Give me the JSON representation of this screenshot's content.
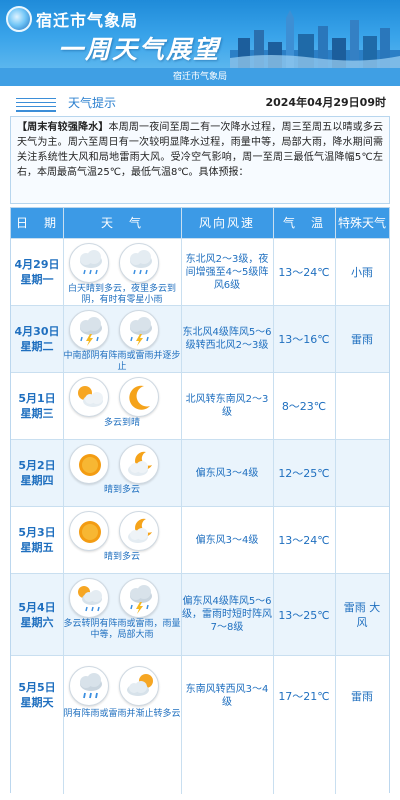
{
  "header": {
    "logo_text": "宿迁市气象局",
    "title": "一周天气展望",
    "subtitle": "宿迁市气象局"
  },
  "tip": {
    "label": "天气提示",
    "date": "2024年04月29日09时",
    "highlight": "【周末有较强降水】",
    "body": "本周周一夜间至周二有一次降水过程，周三至周五以晴或多云天气为主。周六至周日有一次较明显降水过程，雨量中等，局部大雨，降水期间需关注系统性大风和局地雷雨大风。受冷空气影响，周一至周三最低气温降幅5℃左右，本周最高气温25℃，最低气温8℃。具体预报："
  },
  "table": {
    "headers": {
      "date": "日　期",
      "weather": "天　气",
      "wind": "风向风速",
      "temp": "气　温",
      "special": "特殊天气"
    },
    "rows": [
      {
        "date": "4月29日",
        "weekday": "星期一",
        "icon1": "light-rain-cloud-icon",
        "icon2": "light-rain-cloud-icon",
        "desc": "白天晴到多云，夜里多云到阴，有时有零星小雨",
        "wind": "东北风2～3级，夜间增强至4～5级阵风6级",
        "temp": "13～24℃",
        "special": "小雨"
      },
      {
        "date": "4月30日",
        "weekday": "星期二",
        "icon1": "thunder-rain-icon",
        "icon2": "thunder-rain-icon",
        "desc": "中南部阴有阵雨或雷雨并逐步止",
        "wind": "东北风4级阵风5～6级转西北风2～3级",
        "temp": "13～16℃",
        "special": "雷雨"
      },
      {
        "date": "5月1日",
        "weekday": "星期三",
        "icon1": "partly-cloudy-icon",
        "icon2": "moon-icon",
        "desc": "多云到晴",
        "wind": "北风转东南风2～3级",
        "temp": "8～23℃",
        "special": ""
      },
      {
        "date": "5月2日",
        "weekday": "星期四",
        "icon1": "sun-icon",
        "icon2": "cloud-moon-icon",
        "desc": "晴到多云",
        "wind": "偏东风3～4级",
        "temp": "12～25℃",
        "special": ""
      },
      {
        "date": "5月3日",
        "weekday": "星期五",
        "icon1": "sun-icon",
        "icon2": "cloud-moon-icon",
        "desc": "晴到多云",
        "wind": "偏东风3～4级",
        "temp": "13～24℃",
        "special": ""
      },
      {
        "date": "5月4日",
        "weekday": "星期六",
        "icon1": "cloud-sun-rain-icon",
        "icon2": "thunder-rain-icon",
        "desc": "多云转阴有阵雨或雷雨，雨量中等，局部大雨",
        "wind": "偏东风4级阵风5～6级，雷雨时短时阵风7～8级",
        "temp": "13～25℃",
        "special": "雷雨 大风"
      },
      {
        "date": "5月5日",
        "weekday": "星期天",
        "icon1": "rain-cloud-icon",
        "icon2": "cloud-sun-icon",
        "desc": "阴有阵雨或雷雨并渐止转多云",
        "wind": "东南风转西风3～4级",
        "temp": "17～21℃",
        "special": "雷雨"
      }
    ]
  },
  "colors": {
    "header_blue": "#3aa4ea",
    "table_head": "#3c9ae6",
    "text_blue": "#1f6fbf",
    "row_alt": "#eaf4fc"
  }
}
